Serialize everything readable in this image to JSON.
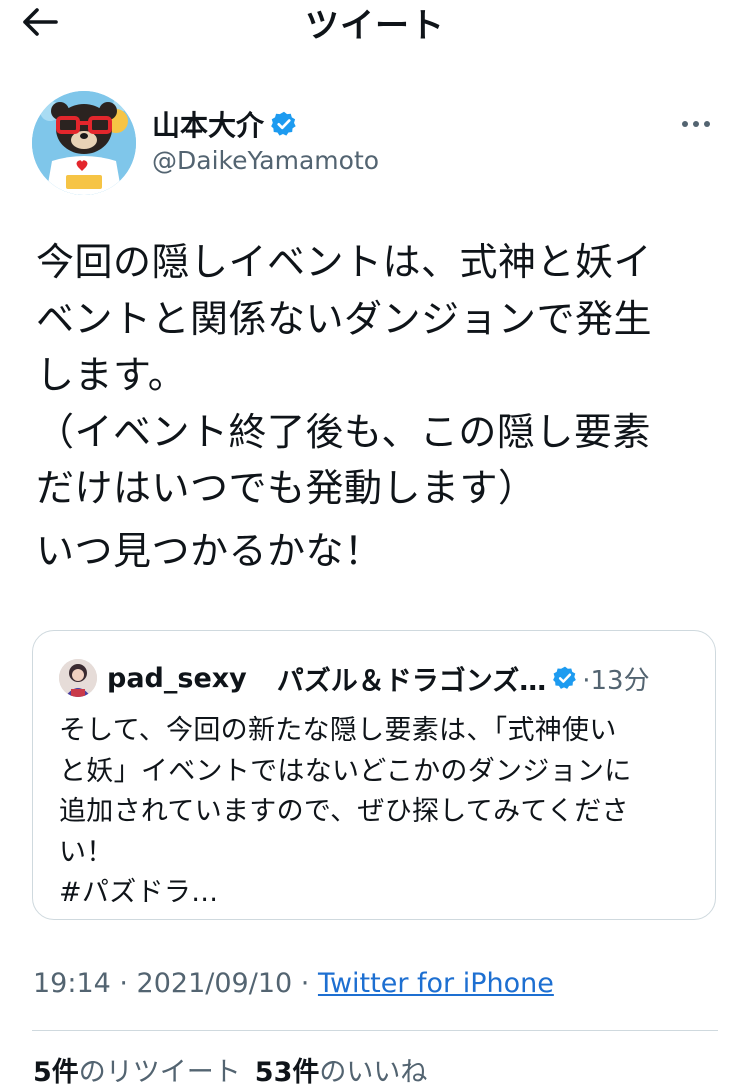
{
  "header": {
    "title": "ツイート"
  },
  "author": {
    "name": "山本大介",
    "handle": "@DaikeYamamoto",
    "verified": true
  },
  "tweet": {
    "paragraph1": "今回の隠しイベントは、式神と妖イ\nベントと関係ないダンジョンで発生\nします。\n（イベント終了後も、この隠し要素\nだけはいつでも発動します）",
    "paragraph2": "いつ見つかるかな！"
  },
  "quote": {
    "username": "pad_sexy",
    "display_name": "パズル＆ドラゴンズ…",
    "time": "·13分",
    "text": "そして、今回の新たな隠し要素は、「式神使い\nと妖」イベントではないどこかのダンジョンに\n追加されていますので、ぜひ探してみてくださ\nい！\n #パズドラ…"
  },
  "meta": {
    "time_date": "19:14 · 2021/09/10 · ",
    "source": "Twitter for iPhone"
  },
  "stats": {
    "retweets_count": "5件",
    "retweets_label": "のリツイート",
    "likes_count": "53件",
    "likes_label": "のいいね"
  },
  "colors": {
    "verified": "#1d9bf0",
    "link": "#1d6fd1",
    "muted": "#536471"
  }
}
